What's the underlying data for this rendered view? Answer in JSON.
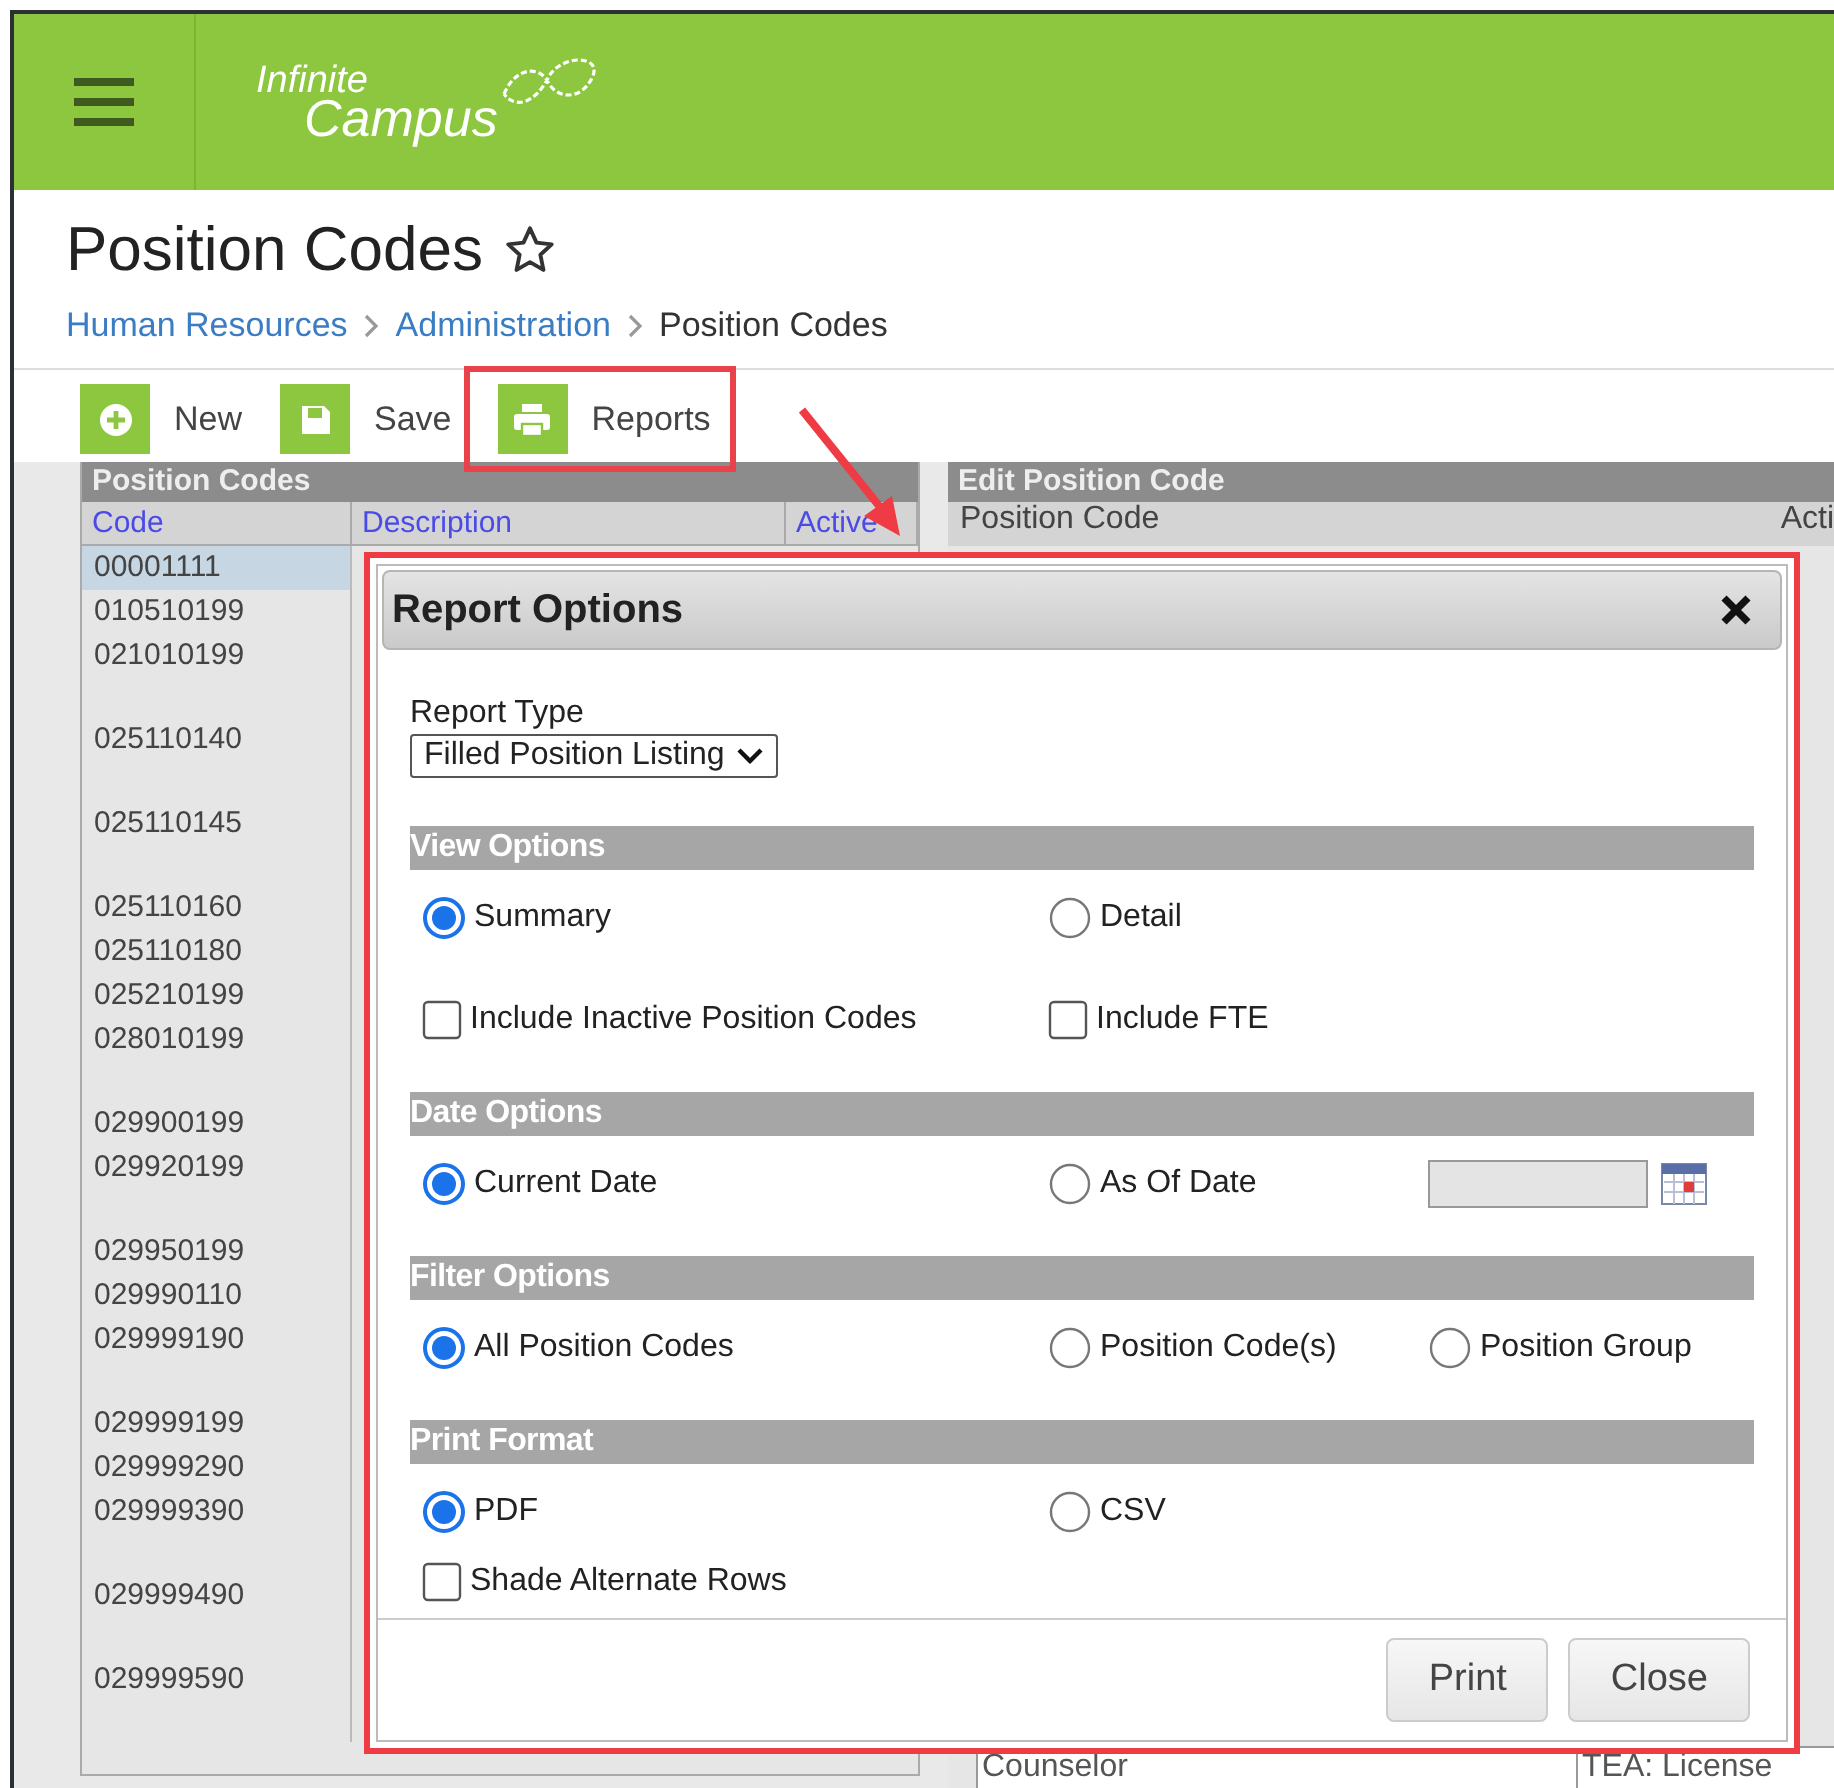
{
  "header": {
    "logo_line_1": "Infinite",
    "logo_line_2": "Campus"
  },
  "page": {
    "title": "Position Codes",
    "favorite": false
  },
  "breadcrumb": [
    {
      "label": "Human Resources",
      "kind": "link"
    },
    {
      "label": "Administration",
      "kind": "link"
    },
    {
      "label": "Position Codes",
      "kind": "current"
    }
  ],
  "toolbar": [
    {
      "label": "New",
      "kind": "new",
      "highlighted": false
    },
    {
      "label": "Save",
      "kind": "save",
      "highlighted": false
    },
    {
      "label": "Reports",
      "kind": "print",
      "highlighted": true
    }
  ],
  "list_panel": {
    "title": "Position Codes",
    "columns": [
      "Code",
      "Description",
      "Active"
    ],
    "rows": [
      {
        "code": "00001111",
        "kind": "short",
        "selected": true
      },
      {
        "code": "010510199",
        "kind": "short",
        "selected": false
      },
      {
        "code": "021010199",
        "kind": "tall",
        "selected": false
      },
      {
        "code": "025110140",
        "kind": "tall",
        "selected": false
      },
      {
        "code": "025110145",
        "kind": "tall",
        "selected": false
      },
      {
        "code": "025110160",
        "kind": "short",
        "selected": false
      },
      {
        "code": "025110180",
        "kind": "short",
        "selected": false
      },
      {
        "code": "025210199",
        "kind": "short",
        "selected": false
      },
      {
        "code": "028010199",
        "kind": "tall",
        "selected": false
      },
      {
        "code": "029900199",
        "kind": "short",
        "selected": false
      },
      {
        "code": "029920199",
        "kind": "tall",
        "selected": false
      },
      {
        "code": "029950199",
        "kind": "short",
        "selected": false
      },
      {
        "code": "029990110",
        "kind": "short",
        "selected": false
      },
      {
        "code": "029999190",
        "kind": "tall",
        "selected": false
      },
      {
        "code": "029999199",
        "kind": "short",
        "selected": false
      },
      {
        "code": "029999290",
        "kind": "short",
        "selected": false
      },
      {
        "code": "029999390",
        "kind": "tall",
        "selected": false
      },
      {
        "code": "029999490",
        "kind": "tall",
        "selected": false
      },
      {
        "code": "029999590",
        "kind": "tall",
        "selected": false
      }
    ]
  },
  "edit_panel": {
    "title": "Edit Position Code",
    "field_label": "Position Code",
    "active_label": "Acti",
    "bottom_row": [
      "Counselor",
      "TEA: License"
    ]
  },
  "dialog": {
    "title": "Report Options",
    "report_type_label": "Report Type",
    "report_type_value": "Filled Position Listing",
    "sections": [
      {
        "title": "View Options",
        "rows": [
          [
            {
              "kind": "radio",
              "label": "Summary",
              "checked": true
            },
            {
              "kind": "radio",
              "label": "Detail",
              "checked": false
            }
          ],
          [
            {
              "kind": "checkbox",
              "label": "Include Inactive Position Codes",
              "checked": false
            },
            {
              "kind": "checkbox",
              "label": "Include FTE",
              "checked": false
            }
          ]
        ]
      },
      {
        "title": "Date Options",
        "rows": [
          [
            {
              "kind": "radio",
              "label": "Current Date",
              "checked": true
            },
            {
              "kind": "radio",
              "label": "As Of Date",
              "checked": false
            },
            {
              "kind": "date",
              "disabled": true
            }
          ]
        ]
      },
      {
        "title": "Filter Options",
        "rows": [
          [
            {
              "kind": "radio",
              "label": "All Position Codes",
              "checked": true
            },
            {
              "kind": "radio",
              "label": "Position Code(s)",
              "checked": false
            },
            {
              "kind": "radio",
              "label": "Position Group",
              "checked": false
            }
          ]
        ]
      },
      {
        "title": "Print Format",
        "rows": [
          [
            {
              "kind": "radio",
              "label": "PDF",
              "checked": true
            },
            {
              "kind": "radio",
              "label": "CSV",
              "checked": false
            }
          ],
          [
            {
              "kind": "checkbox",
              "label": "Shade Alternate Rows",
              "checked": false
            }
          ]
        ]
      }
    ],
    "buttons": [
      "Print",
      "Close"
    ]
  }
}
